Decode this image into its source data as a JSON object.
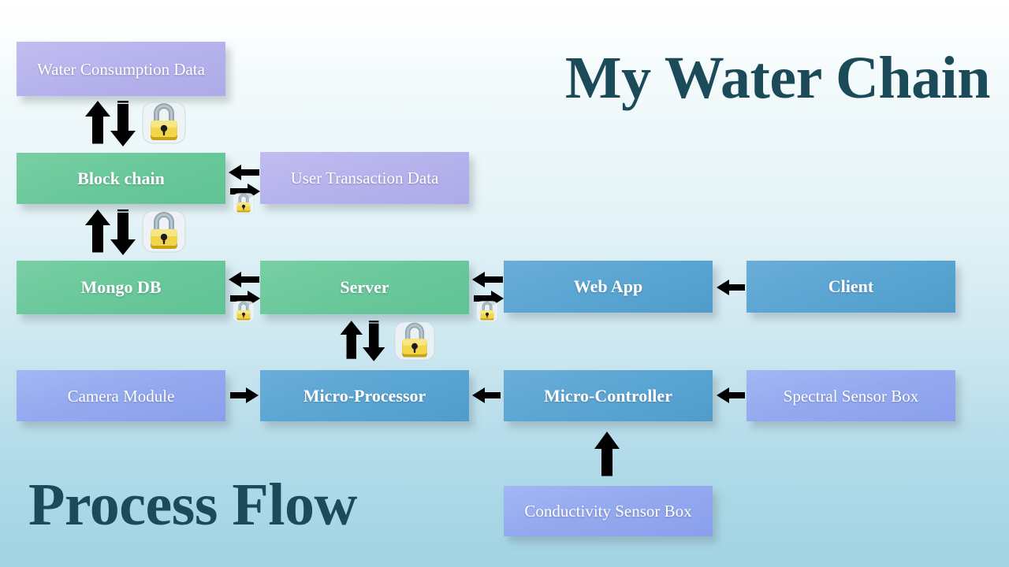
{
  "titles": {
    "main": "My Water Chain",
    "sub": "Process Flow"
  },
  "colors": {
    "green": "#6bc99c",
    "blue": "#5ca6d3",
    "violet": "#b6b2ec",
    "periwinkle": "#93a9ef",
    "title_text": "#1b4a58",
    "node_text": "#ffffff",
    "arrow": "#000000",
    "lock_body": "#e8c93a",
    "lock_shackle": "#8fa3ad",
    "background_top": "#ffffff",
    "background_bottom": "#a2d4e4"
  },
  "nodes": [
    {
      "id": "water-consumption-data",
      "label": "Water Consumption  Data",
      "fill": "violet",
      "bold": false
    },
    {
      "id": "block-chain",
      "label": "Block chain",
      "fill": "green",
      "bold": true
    },
    {
      "id": "user-transaction-data",
      "label": "User Transaction  Data",
      "fill": "violet",
      "bold": false
    },
    {
      "id": "mongo-db",
      "label": "Mongo DB",
      "fill": "green",
      "bold": true
    },
    {
      "id": "server",
      "label": "Server",
      "fill": "green",
      "bold": true
    },
    {
      "id": "web-app",
      "label": "Web App",
      "fill": "blue",
      "bold": true
    },
    {
      "id": "client",
      "label": "Client",
      "fill": "blue",
      "bold": true
    },
    {
      "id": "camera-module",
      "label": "Camera Module",
      "fill": "periwinkle",
      "bold": false
    },
    {
      "id": "micro-processor",
      "label": "Micro-Processor",
      "fill": "blue",
      "bold": true
    },
    {
      "id": "micro-controller",
      "label": "Micro-Controller",
      "fill": "blue",
      "bold": true
    },
    {
      "id": "spectral-sensor-box",
      "label": "Spectral Sensor  Box",
      "fill": "periwinkle",
      "bold": false
    },
    {
      "id": "conductivity-sensor-box",
      "label": "Conductivity  Sensor Box",
      "fill": "periwinkle",
      "bold": false
    }
  ],
  "connectors": [
    {
      "id": "water-consumption-data--block-chain",
      "kind": "bidirectional-vertical",
      "secured": true
    },
    {
      "id": "block-chain--user-transaction-data",
      "kind": "bidirectional-horizontal",
      "secured": true
    },
    {
      "id": "block-chain--mongo-db",
      "kind": "bidirectional-vertical",
      "secured": true
    },
    {
      "id": "mongo-db--server",
      "kind": "bidirectional-horizontal",
      "secured": true
    },
    {
      "id": "server--web-app",
      "kind": "bidirectional-horizontal",
      "secured": true
    },
    {
      "id": "client--web-app",
      "kind": "left-arrow",
      "secured": false
    },
    {
      "id": "server--micro-processor",
      "kind": "bidirectional-vertical",
      "secured": true
    },
    {
      "id": "camera-module--micro-processor",
      "kind": "right-arrow",
      "secured": false
    },
    {
      "id": "micro-controller--micro-processor",
      "kind": "left-arrow",
      "secured": false
    },
    {
      "id": "spectral-sensor-box--micro-controller",
      "kind": "left-arrow",
      "secured": false
    },
    {
      "id": "conductivity-sensor-box--micro-controller",
      "kind": "up-arrow",
      "secured": false
    }
  ],
  "icons": {
    "lock": "padlock-icon",
    "arrow_up": "arrow-up-icon",
    "arrow_down": "arrow-down-icon",
    "arrow_left": "arrow-left-icon",
    "arrow_right": "arrow-right-icon"
  }
}
